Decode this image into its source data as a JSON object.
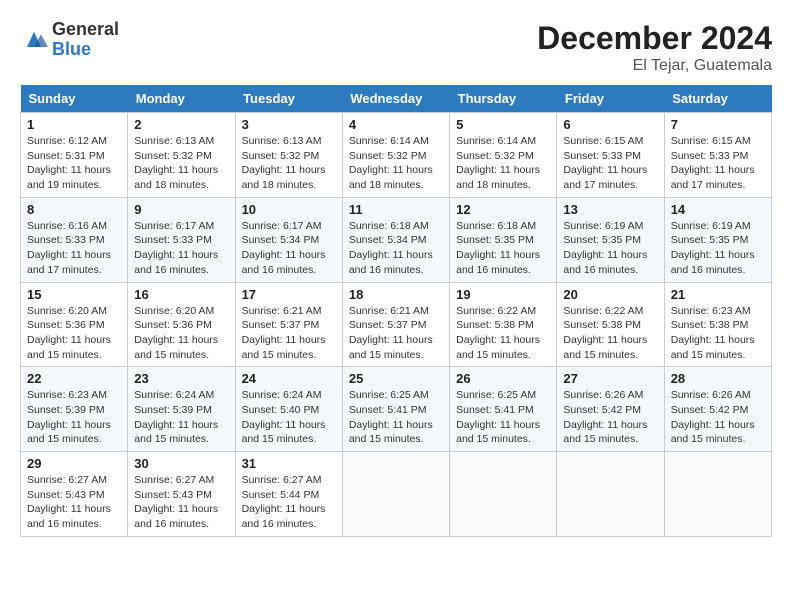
{
  "header": {
    "logo_line1": "General",
    "logo_line2": "Blue",
    "month": "December 2024",
    "location": "El Tejar, Guatemala"
  },
  "weekdays": [
    "Sunday",
    "Monday",
    "Tuesday",
    "Wednesday",
    "Thursday",
    "Friday",
    "Saturday"
  ],
  "weeks": [
    [
      {
        "day": "1",
        "info": "Sunrise: 6:12 AM\nSunset: 5:31 PM\nDaylight: 11 hours\nand 19 minutes."
      },
      {
        "day": "2",
        "info": "Sunrise: 6:13 AM\nSunset: 5:32 PM\nDaylight: 11 hours\nand 18 minutes."
      },
      {
        "day": "3",
        "info": "Sunrise: 6:13 AM\nSunset: 5:32 PM\nDaylight: 11 hours\nand 18 minutes."
      },
      {
        "day": "4",
        "info": "Sunrise: 6:14 AM\nSunset: 5:32 PM\nDaylight: 11 hours\nand 18 minutes."
      },
      {
        "day": "5",
        "info": "Sunrise: 6:14 AM\nSunset: 5:32 PM\nDaylight: 11 hours\nand 18 minutes."
      },
      {
        "day": "6",
        "info": "Sunrise: 6:15 AM\nSunset: 5:33 PM\nDaylight: 11 hours\nand 17 minutes."
      },
      {
        "day": "7",
        "info": "Sunrise: 6:15 AM\nSunset: 5:33 PM\nDaylight: 11 hours\nand 17 minutes."
      }
    ],
    [
      {
        "day": "8",
        "info": "Sunrise: 6:16 AM\nSunset: 5:33 PM\nDaylight: 11 hours\nand 17 minutes."
      },
      {
        "day": "9",
        "info": "Sunrise: 6:17 AM\nSunset: 5:33 PM\nDaylight: 11 hours\nand 16 minutes."
      },
      {
        "day": "10",
        "info": "Sunrise: 6:17 AM\nSunset: 5:34 PM\nDaylight: 11 hours\nand 16 minutes."
      },
      {
        "day": "11",
        "info": "Sunrise: 6:18 AM\nSunset: 5:34 PM\nDaylight: 11 hours\nand 16 minutes."
      },
      {
        "day": "12",
        "info": "Sunrise: 6:18 AM\nSunset: 5:35 PM\nDaylight: 11 hours\nand 16 minutes."
      },
      {
        "day": "13",
        "info": "Sunrise: 6:19 AM\nSunset: 5:35 PM\nDaylight: 11 hours\nand 16 minutes."
      },
      {
        "day": "14",
        "info": "Sunrise: 6:19 AM\nSunset: 5:35 PM\nDaylight: 11 hours\nand 16 minutes."
      }
    ],
    [
      {
        "day": "15",
        "info": "Sunrise: 6:20 AM\nSunset: 5:36 PM\nDaylight: 11 hours\nand 15 minutes."
      },
      {
        "day": "16",
        "info": "Sunrise: 6:20 AM\nSunset: 5:36 PM\nDaylight: 11 hours\nand 15 minutes."
      },
      {
        "day": "17",
        "info": "Sunrise: 6:21 AM\nSunset: 5:37 PM\nDaylight: 11 hours\nand 15 minutes."
      },
      {
        "day": "18",
        "info": "Sunrise: 6:21 AM\nSunset: 5:37 PM\nDaylight: 11 hours\nand 15 minutes."
      },
      {
        "day": "19",
        "info": "Sunrise: 6:22 AM\nSunset: 5:38 PM\nDaylight: 11 hours\nand 15 minutes."
      },
      {
        "day": "20",
        "info": "Sunrise: 6:22 AM\nSunset: 5:38 PM\nDaylight: 11 hours\nand 15 minutes."
      },
      {
        "day": "21",
        "info": "Sunrise: 6:23 AM\nSunset: 5:38 PM\nDaylight: 11 hours\nand 15 minutes."
      }
    ],
    [
      {
        "day": "22",
        "info": "Sunrise: 6:23 AM\nSunset: 5:39 PM\nDaylight: 11 hours\nand 15 minutes."
      },
      {
        "day": "23",
        "info": "Sunrise: 6:24 AM\nSunset: 5:39 PM\nDaylight: 11 hours\nand 15 minutes."
      },
      {
        "day": "24",
        "info": "Sunrise: 6:24 AM\nSunset: 5:40 PM\nDaylight: 11 hours\nand 15 minutes."
      },
      {
        "day": "25",
        "info": "Sunrise: 6:25 AM\nSunset: 5:41 PM\nDaylight: 11 hours\nand 15 minutes."
      },
      {
        "day": "26",
        "info": "Sunrise: 6:25 AM\nSunset: 5:41 PM\nDaylight: 11 hours\nand 15 minutes."
      },
      {
        "day": "27",
        "info": "Sunrise: 6:26 AM\nSunset: 5:42 PM\nDaylight: 11 hours\nand 15 minutes."
      },
      {
        "day": "28",
        "info": "Sunrise: 6:26 AM\nSunset: 5:42 PM\nDaylight: 11 hours\nand 15 minutes."
      }
    ],
    [
      {
        "day": "29",
        "info": "Sunrise: 6:27 AM\nSunset: 5:43 PM\nDaylight: 11 hours\nand 16 minutes."
      },
      {
        "day": "30",
        "info": "Sunrise: 6:27 AM\nSunset: 5:43 PM\nDaylight: 11 hours\nand 16 minutes."
      },
      {
        "day": "31",
        "info": "Sunrise: 6:27 AM\nSunset: 5:44 PM\nDaylight: 11 hours\nand 16 minutes."
      },
      {
        "day": "",
        "info": ""
      },
      {
        "day": "",
        "info": ""
      },
      {
        "day": "",
        "info": ""
      },
      {
        "day": "",
        "info": ""
      }
    ]
  ]
}
